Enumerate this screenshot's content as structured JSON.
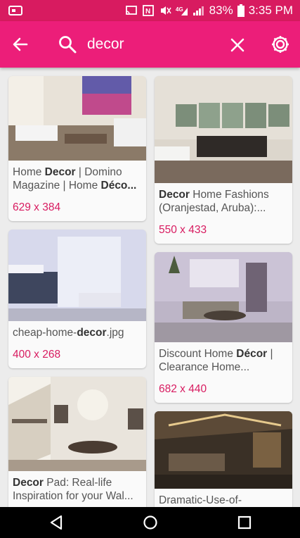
{
  "status": {
    "battery": "83%",
    "time": "3:35 PM"
  },
  "search": {
    "query": "decor"
  },
  "colors": {
    "accent": "#ec1e79",
    "status_bar": "#d81b60",
    "dims_text": "#d81b60"
  },
  "results": {
    "left": [
      {
        "caption_parts": [
          [
            "Home ",
            false
          ],
          [
            "Decor",
            true
          ],
          [
            " | Domino Magazine | Home ",
            false
          ],
          [
            "Déco...",
            true
          ]
        ],
        "dims": "629 x 384"
      },
      {
        "caption_parts": [
          [
            "cheap-home-",
            false
          ],
          [
            "decor",
            true
          ],
          [
            ".jpg",
            false
          ]
        ],
        "dims": "400 x 268"
      },
      {
        "caption_parts": [
          [
            "Decor",
            true
          ],
          [
            " Pad: Real-life Inspiration for your Wal...",
            false
          ]
        ],
        "dims": ""
      }
    ],
    "right": [
      {
        "caption_parts": [
          [
            "Decor",
            true
          ],
          [
            " Home Fashions (Oranjestad, Aruba):...",
            false
          ]
        ],
        "dims": "550 x 433"
      },
      {
        "caption_parts": [
          [
            "Discount Home ",
            false
          ],
          [
            "Décor",
            true
          ],
          [
            " | Clearance Home...",
            false
          ]
        ],
        "dims": "682 x 440"
      },
      {
        "caption_parts": [
          [
            "Dramatic-Use-of-",
            false
          ]
        ],
        "dims": ""
      }
    ]
  },
  "icons": {
    "back": "arrow-back-icon",
    "search": "search-icon",
    "clear": "close-icon",
    "settings": "gear-icon",
    "nav_back": "triangle-back-icon",
    "nav_home": "circle-home-icon",
    "nav_recents": "square-recents-icon"
  }
}
